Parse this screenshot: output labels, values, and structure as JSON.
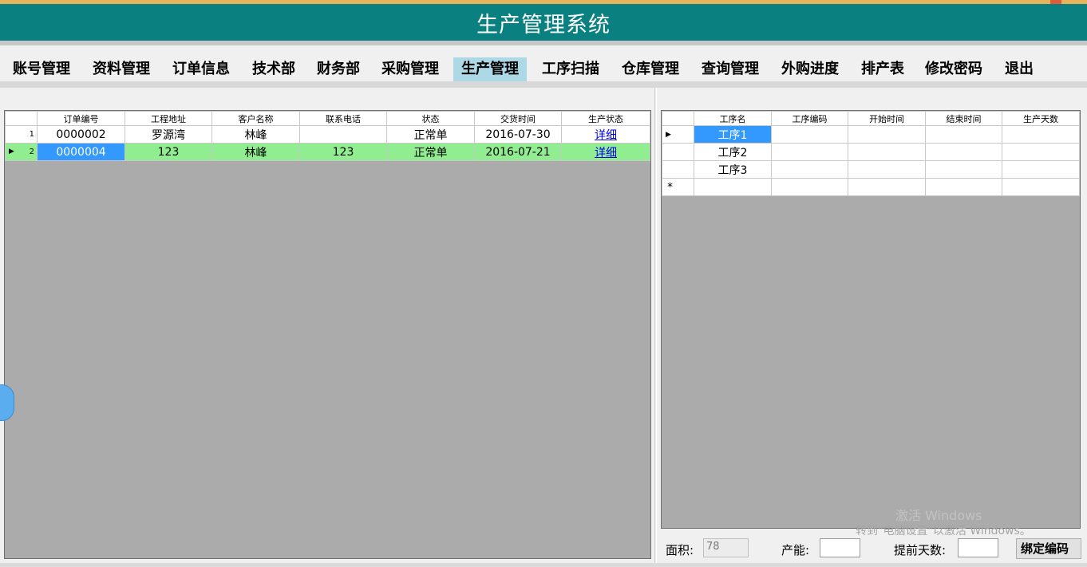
{
  "app": {
    "title": "生产管理系统"
  },
  "menu": {
    "items": [
      {
        "label": "账号管理"
      },
      {
        "label": "资料管理"
      },
      {
        "label": "订单信息"
      },
      {
        "label": "技术部"
      },
      {
        "label": "财务部"
      },
      {
        "label": "采购管理"
      },
      {
        "label": "生产管理"
      },
      {
        "label": "工序扫描"
      },
      {
        "label": "仓库管理"
      },
      {
        "label": "查询管理"
      },
      {
        "label": "外购进度"
      },
      {
        "label": "排产表"
      },
      {
        "label": "修改密码"
      },
      {
        "label": "退出"
      }
    ],
    "active_index": 6
  },
  "orders_grid": {
    "columns": [
      "订单编号",
      "工程地址",
      "客户名称",
      "联系电话",
      "状态",
      "交货时间",
      "生产状态"
    ],
    "rows": [
      {
        "num": "1",
        "order_no": "0000002",
        "address": "罗源湾",
        "customer": "林峰",
        "phone": "",
        "status": "正常单",
        "delivery": "2016-07-30",
        "prod_status": "详细"
      },
      {
        "num": "2",
        "order_no": "0000004",
        "address": "123",
        "customer": "林峰",
        "phone": "123",
        "status": "正常单",
        "delivery": "2016-07-21",
        "prod_status": "详细"
      }
    ],
    "selected_row": 2,
    "row_colors": {
      "selected": "#90ee90",
      "selected_cell": "#3399ff"
    }
  },
  "process_grid": {
    "columns": [
      "工序名",
      "工序编码",
      "开始时间",
      "结束时间",
      "生产天数"
    ],
    "rows": [
      {
        "name": "工序1",
        "code": "",
        "start": "",
        "end": "",
        "days": ""
      },
      {
        "name": "工序2",
        "code": "",
        "start": "",
        "end": "",
        "days": ""
      },
      {
        "name": "工序3",
        "code": "",
        "start": "",
        "end": "",
        "days": ""
      }
    ],
    "new_row_marker": "*"
  },
  "form": {
    "area_label": "面积:",
    "area_value": "78",
    "capacity_label": "产能:",
    "capacity_value": "",
    "advance_days_label": "提前天数:",
    "advance_days_value": "",
    "bind_button": "绑定编码"
  },
  "watermark": {
    "line1": "激活 Windows",
    "line2": "转到\"电脑设置\"以激活 Windows。"
  },
  "colors": {
    "titlebar": "#0a8080",
    "menu_active": "#add8e6",
    "grid_bg": "#ababab",
    "link": "#0000ee"
  }
}
